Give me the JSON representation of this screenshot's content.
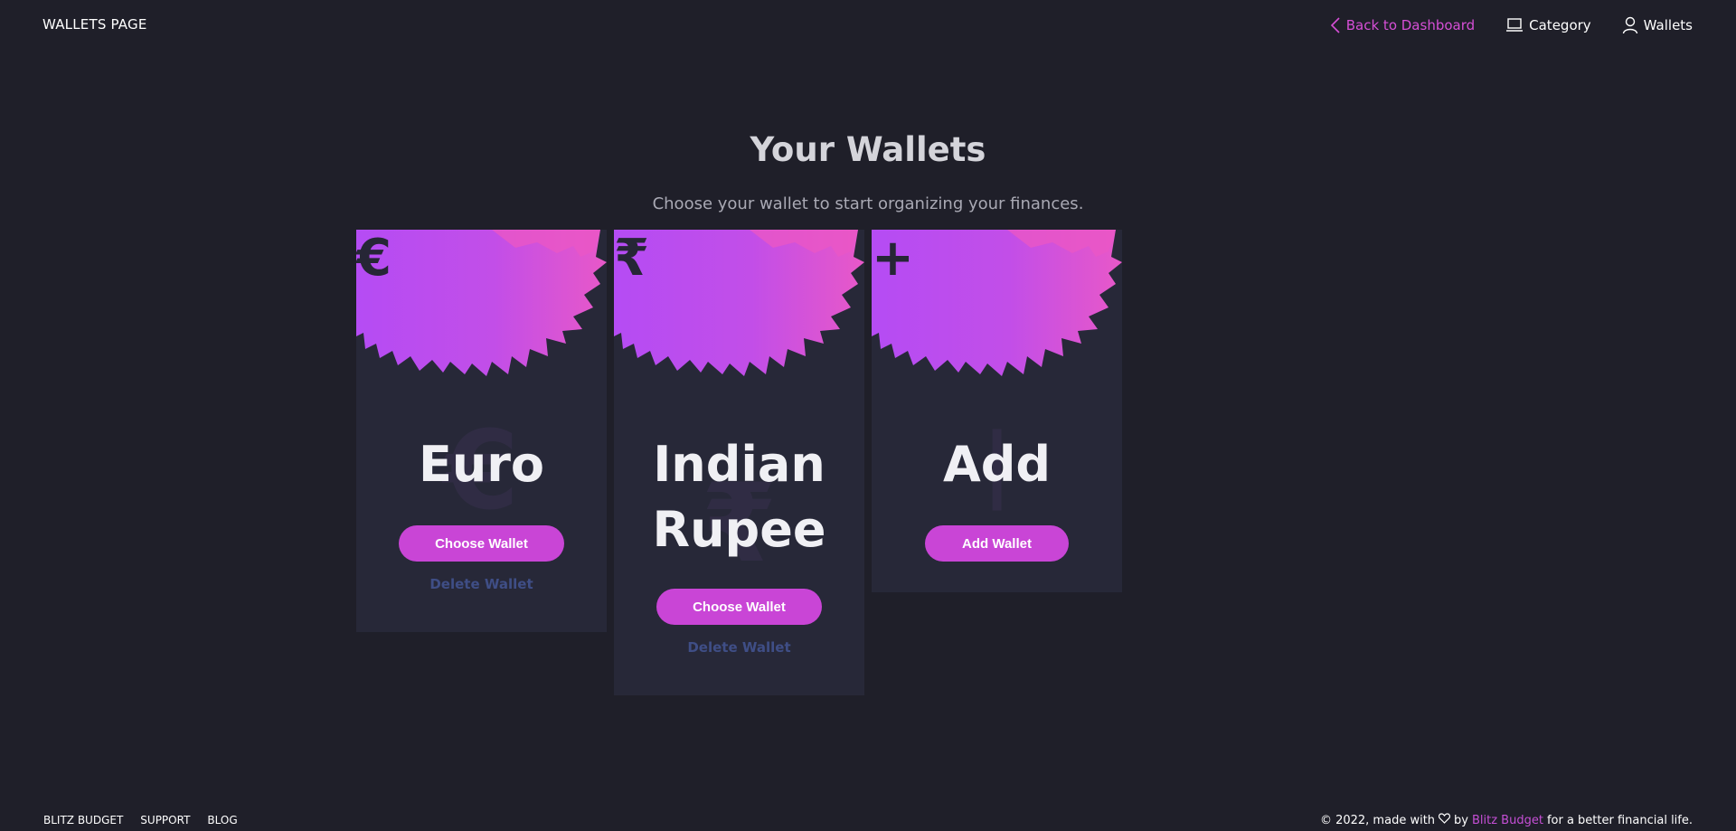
{
  "header": {
    "brand": "WALLETS PAGE",
    "nav": {
      "back": "Back to Dashboard",
      "category": "Category",
      "wallets": "Wallets"
    }
  },
  "hero": {
    "title": "Your Wallets",
    "subtitle": "Choose your wallet to start organizing your finances."
  },
  "cards": [
    {
      "symbol": "€",
      "title_lines": [
        "Euro"
      ],
      "button": "Choose Wallet",
      "delete": "Delete Wallet"
    },
    {
      "symbol": "₹",
      "title_lines": [
        "Indian",
        "Rupee"
      ],
      "button": "Choose Wallet",
      "delete": "Delete Wallet"
    },
    {
      "symbol": "+",
      "title_lines": [
        "Add"
      ],
      "button": "Add Wallet"
    }
  ],
  "footer": {
    "links": [
      "BLITZ BUDGET",
      "SUPPORT",
      "BLOG"
    ],
    "copy_prefix": "© 2022, made with",
    "by": "by",
    "brand_link": "Blitz Budget",
    "copy_suffix": "for a better financial life."
  },
  "colors": {
    "background": "#1f1f29",
    "card": "#272838",
    "accent": "#c945d6",
    "accent_light": "#e060f0",
    "muted_link": "#3f4e86"
  },
  "icons": {
    "back": "chevron-left-icon",
    "category": "laptop-icon",
    "wallets": "user-icon",
    "heart": "heart-icon"
  }
}
